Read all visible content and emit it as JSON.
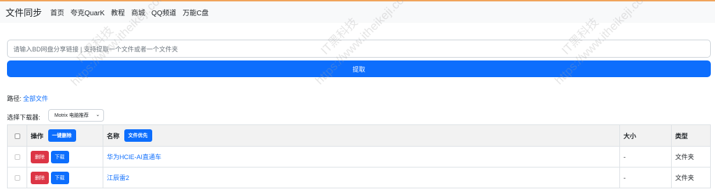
{
  "nav": {
    "brand": "文件同步",
    "links": [
      "首页",
      "夸克QuarK",
      "教程",
      "商城",
      "QQ频道",
      "万能C盘"
    ]
  },
  "search": {
    "placeholder": "请输入BD网盘分享链接 | 支持提取一个文件或者一个文件夹"
  },
  "extract_button": "提取",
  "path": {
    "label": "路径:",
    "value": "全部文件"
  },
  "downloader": {
    "label": "选择下载器:",
    "selected": "Motrix 电脑推荐"
  },
  "table": {
    "headers": {
      "ops": "操作",
      "bulk_delete": "一键删除",
      "name": "名称",
      "file_priority": "文件优先",
      "size": "大小",
      "type": "类型"
    },
    "delete_label": "删除",
    "download_label": "下载",
    "rows": [
      {
        "name": "华为HCIE-AI直通车",
        "size": "-",
        "type": "文件夹"
      },
      {
        "name": "江辰雷2",
        "size": "-",
        "type": "文件夹"
      }
    ]
  },
  "watermark": [
    "IT黑科技",
    "https://www.itheikeji.com"
  ]
}
